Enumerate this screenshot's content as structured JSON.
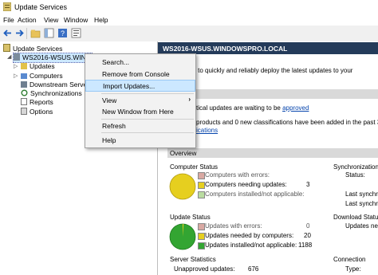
{
  "window": {
    "title": "Update Services"
  },
  "menu": [
    "File",
    "Action",
    "View",
    "Window",
    "Help"
  ],
  "tree": {
    "root": "Update Services",
    "server": "WS2016-WSUS.WINDOWSPRO.LOCAL",
    "items": [
      "Updates",
      "Computers",
      "Downstream Servers",
      "Synchronizations",
      "Reports",
      "Options"
    ]
  },
  "context_menu": {
    "items": [
      "Search...",
      "Remove from Console",
      "Import Updates...",
      "View",
      "New Window from Here",
      "Refresh",
      "Help"
    ],
    "highlighted": "Import Updates..."
  },
  "right": {
    "banner": "WS2016-WSUS.WINDOWSPRO.LOCAL",
    "intro": "this snap-in to quickly and reliably deploy the latest updates to your",
    "critical_prefix": "tical updates are waiting to be",
    "critical_link": "approved",
    "classif_text": "products and 0 new classifications have been added in the past 30",
    "classif_link": "ications",
    "overview": "Overview",
    "computer_status": {
      "title": "Computer Status",
      "rows": [
        {
          "label": "Computers with errors:",
          "value": ""
        },
        {
          "label": "Computers needing updates:",
          "value": "3"
        },
        {
          "label": "Computers installed/not applicable:",
          "value": ""
        }
      ]
    },
    "update_status": {
      "title": "Update Status",
      "rows": [
        {
          "label": "Updates with errors:",
          "value": "0"
        },
        {
          "label": "Updates needed by computers:",
          "value": "20"
        },
        {
          "label": "Updates installed/not applicable:",
          "value": "1188"
        }
      ]
    },
    "server_statistics": {
      "title": "Server Statistics",
      "row": {
        "label": "Unapproved updates:",
        "value": "676"
      }
    },
    "sync": {
      "title": "Synchronization",
      "status": "Status:",
      "last1": "Last synchr",
      "last2": "Last synchr"
    },
    "download": {
      "title": "Download Status",
      "updates": "Updates ne"
    },
    "connection": {
      "title": "Connection",
      "type": "Type:"
    }
  }
}
